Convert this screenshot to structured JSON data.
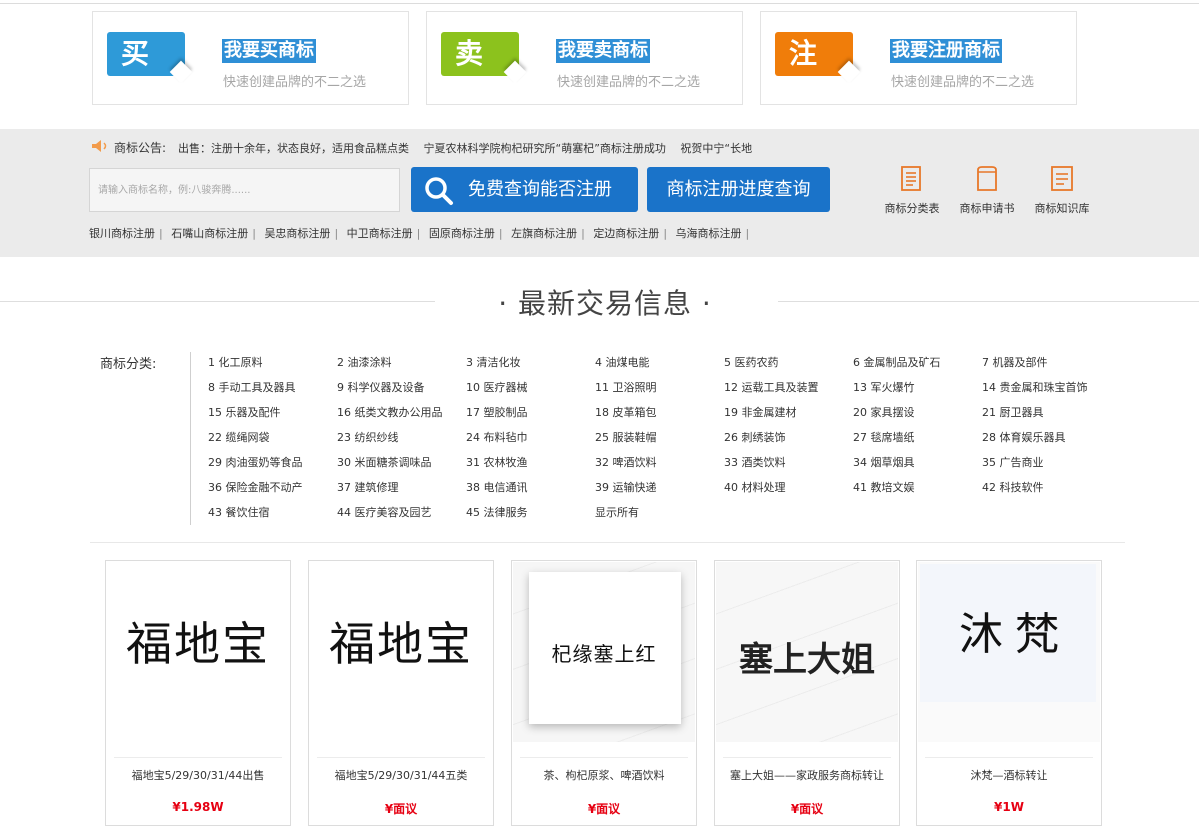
{
  "services": [
    {
      "char": "买",
      "title": "我要买商标",
      "sub": "快速创建品牌的不二之选",
      "color": "#2e9ad8"
    },
    {
      "char": "卖",
      "title": "我要卖商标",
      "sub": "快速创建品牌的不二之选",
      "color": "#8cc21d"
    },
    {
      "char": "注",
      "title": "我要注册商标",
      "sub": "快速创建品牌的不二之选",
      "color": "#f07d0a"
    }
  ],
  "notice": {
    "label": "商标公告:",
    "text": "出售：注册十余年，状态良好，适用食品糕点类　 宁夏农林科学院枸杞研究所“萌塞杞”商标注册成功　 祝贺中宁“长地"
  },
  "search": {
    "placeholder": "请输入商标名称，例:八骏奔腾......",
    "query_button": "免费查询能否注册",
    "progress_button": "商标注册进度查询"
  },
  "tools": [
    {
      "label": "商标分类表",
      "icon": "document-list-icon"
    },
    {
      "label": "商标申请书",
      "icon": "application-form-icon"
    },
    {
      "label": "商标知识库",
      "icon": "knowledge-doc-icon"
    }
  ],
  "city_links": [
    "银川商标注册",
    "石嘴山商标注册",
    "吴忠商标注册",
    "中卫商标注册",
    "固原商标注册",
    "左旗商标注册",
    "定边商标注册",
    "乌海商标注册"
  ],
  "section_title": "·  最新交易信息  ·",
  "category_label": "商标分类:",
  "categories": [
    "1 化工原料",
    "2 油漆涂料",
    "3 清洁化妆",
    "4 油煤电能",
    "5 医药农药",
    "6 金属制品及矿石",
    "7 机器及部件",
    "8 手动工具及器具",
    "9 科学仪器及设备",
    "10 医疗器械",
    "11 卫浴照明",
    "12 运载工具及装置",
    "13 军火爆竹",
    "14 贵金属和珠宝首饰",
    "15 乐器及配件",
    "16 纸类文教办公用品",
    "17 塑胶制品",
    "18 皮革箱包",
    "19 非金属建材",
    "20 家具摆设",
    "21 厨卫器具",
    "22 缆绳网袋",
    "23 纺织纱线",
    "24 布料毡巾",
    "25 服装鞋帽",
    "26 刺绣装饰",
    "27 毯席墙纸",
    "28 体育娱乐器具",
    "29 肉油蛋奶等食品",
    "30 米面糖茶调味品",
    "31 农林牧渔",
    "32 啤酒饮料",
    "33 酒类饮料",
    "34 烟草烟具",
    "35 广告商业",
    "36 保险金融不动产",
    "37 建筑修理",
    "38 电信通讯",
    "39 运输快递",
    "40 材料处理",
    "41 教培文娱",
    "42 科技软件",
    "43 餐饮住宿",
    "44 医疗美容及园艺",
    "45 法律服务",
    "显示所有"
  ],
  "products": [
    {
      "image_text": "福地宝",
      "caption": "福地宝5/29/30/31/44出售",
      "price": "¥1.98W"
    },
    {
      "image_text": "福地宝",
      "caption": "福地宝5/29/30/31/44五类",
      "price": "¥面议"
    },
    {
      "image_text": "杞缘塞上红",
      "caption": "茶、枸杞原浆、啤酒饮料",
      "price": "¥面议"
    },
    {
      "image_text": "塞上大姐",
      "caption": "塞上大姐——家政服务商标转让",
      "price": "¥面议"
    },
    {
      "image_text": "沐梵",
      "caption": "沐梵—酒标转让",
      "price": "¥1W"
    }
  ]
}
